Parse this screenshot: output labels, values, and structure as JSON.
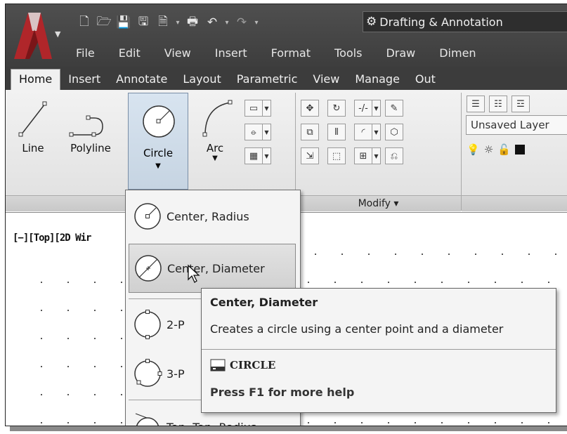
{
  "workspace": {
    "label": "Drafting & Annotation"
  },
  "menubar": [
    "File",
    "Edit",
    "View",
    "Insert",
    "Format",
    "Tools",
    "Draw",
    "Dimen"
  ],
  "ribbon_tabs": [
    "Home",
    "Insert",
    "Annotate",
    "Layout",
    "Parametric",
    "View",
    "Manage",
    "Out"
  ],
  "draw_tools": {
    "line": "Line",
    "polyline": "Polyline",
    "circle": "Circle",
    "arc": "Arc"
  },
  "modify_panel": {
    "label": "Modify ▾"
  },
  "layers": {
    "selector": "Unsaved Layer"
  },
  "viewport": {
    "label": "[−][Top][2D Wir"
  },
  "circle_menu": {
    "items": [
      "Center, Radius",
      "Center, Diameter",
      "2-P",
      "3-P",
      "Tan, Tan, Radius"
    ]
  },
  "tooltip": {
    "title": "Center, Diameter",
    "description": "Creates a circle using a center point and a diameter",
    "command": "CIRCLE",
    "help": "Press F1 for more help"
  },
  "colors": {
    "title_bar": "#444444",
    "ribbon": "#e8e8e8",
    "highlight": "#c6d4e2"
  }
}
